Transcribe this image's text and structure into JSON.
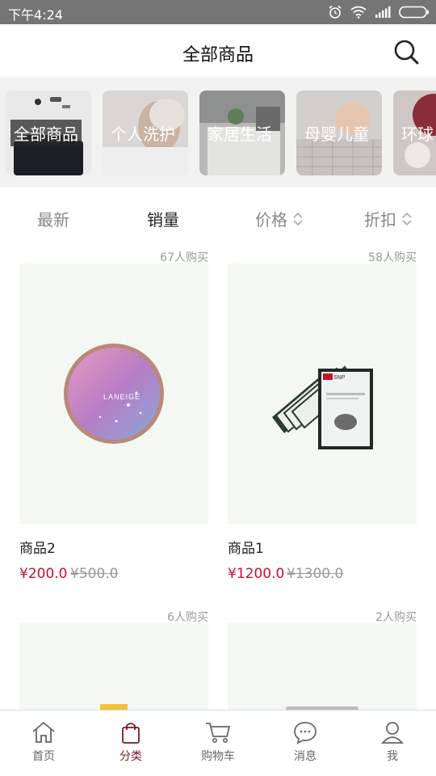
{
  "status_bar": {
    "time": "下午4:24"
  },
  "header": {
    "title": "全部商品"
  },
  "categories": [
    {
      "label": "全部商品"
    },
    {
      "label": "个人洗护"
    },
    {
      "label": "家居生活"
    },
    {
      "label": "母婴儿童"
    },
    {
      "label": "环球"
    }
  ],
  "sort": {
    "newest": "最新",
    "sales": "销量",
    "price": "价格",
    "discount": "折扣"
  },
  "products": [
    {
      "name": "商品2",
      "price": "¥200.0",
      "old_price": "¥500.0",
      "sold": "67人购买",
      "brand": "LANEIGE"
    },
    {
      "name": "商品1",
      "price": "¥1200.0",
      "old_price": "¥1300.0",
      "sold": "58人购买",
      "brand": "SNP"
    },
    {
      "sold": "6人购买"
    },
    {
      "sold": "2人购买"
    }
  ],
  "tabs": [
    {
      "label": "首页",
      "icon": "home-icon"
    },
    {
      "label": "分类",
      "icon": "bag-icon"
    },
    {
      "label": "购物车",
      "icon": "cart-icon"
    },
    {
      "label": "消息",
      "icon": "message-icon"
    },
    {
      "label": "我",
      "icon": "user-icon"
    }
  ],
  "colors": {
    "price_red": "#c8102e",
    "active_tab": "#7a1b22",
    "status_bar": "#757575"
  }
}
